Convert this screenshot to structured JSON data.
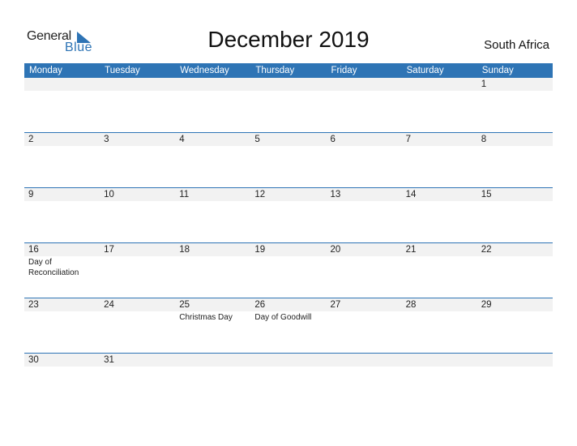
{
  "logo": {
    "general": "General",
    "blue": "Blue"
  },
  "title": "December 2019",
  "country": "South Africa",
  "colors": {
    "accent": "#2e74b5",
    "date_strip": "#f2f2f2"
  },
  "weekdays": [
    "Monday",
    "Tuesday",
    "Wednesday",
    "Thursday",
    "Friday",
    "Saturday",
    "Sunday"
  ],
  "weeks": [
    {
      "days": [
        {
          "num": "",
          "holiday": ""
        },
        {
          "num": "",
          "holiday": ""
        },
        {
          "num": "",
          "holiday": ""
        },
        {
          "num": "",
          "holiday": ""
        },
        {
          "num": "",
          "holiday": ""
        },
        {
          "num": "",
          "holiday": ""
        },
        {
          "num": "1",
          "holiday": ""
        }
      ]
    },
    {
      "days": [
        {
          "num": "2",
          "holiday": ""
        },
        {
          "num": "3",
          "holiday": ""
        },
        {
          "num": "4",
          "holiday": ""
        },
        {
          "num": "5",
          "holiday": ""
        },
        {
          "num": "6",
          "holiday": ""
        },
        {
          "num": "7",
          "holiday": ""
        },
        {
          "num": "8",
          "holiday": ""
        }
      ]
    },
    {
      "days": [
        {
          "num": "9",
          "holiday": ""
        },
        {
          "num": "10",
          "holiday": ""
        },
        {
          "num": "11",
          "holiday": ""
        },
        {
          "num": "12",
          "holiday": ""
        },
        {
          "num": "13",
          "holiday": ""
        },
        {
          "num": "14",
          "holiday": ""
        },
        {
          "num": "15",
          "holiday": ""
        }
      ]
    },
    {
      "days": [
        {
          "num": "16",
          "holiday": "Day of Reconciliation"
        },
        {
          "num": "17",
          "holiday": ""
        },
        {
          "num": "18",
          "holiday": ""
        },
        {
          "num": "19",
          "holiday": ""
        },
        {
          "num": "20",
          "holiday": ""
        },
        {
          "num": "21",
          "holiday": ""
        },
        {
          "num": "22",
          "holiday": ""
        }
      ]
    },
    {
      "days": [
        {
          "num": "23",
          "holiday": ""
        },
        {
          "num": "24",
          "holiday": ""
        },
        {
          "num": "25",
          "holiday": "Christmas Day"
        },
        {
          "num": "26",
          "holiday": "Day of Goodwill"
        },
        {
          "num": "27",
          "holiday": ""
        },
        {
          "num": "28",
          "holiday": ""
        },
        {
          "num": "29",
          "holiday": ""
        }
      ]
    },
    {
      "days": [
        {
          "num": "30",
          "holiday": ""
        },
        {
          "num": "31",
          "holiday": ""
        },
        {
          "num": "",
          "holiday": ""
        },
        {
          "num": "",
          "holiday": ""
        },
        {
          "num": "",
          "holiday": ""
        },
        {
          "num": "",
          "holiday": ""
        },
        {
          "num": "",
          "holiday": ""
        }
      ]
    }
  ]
}
